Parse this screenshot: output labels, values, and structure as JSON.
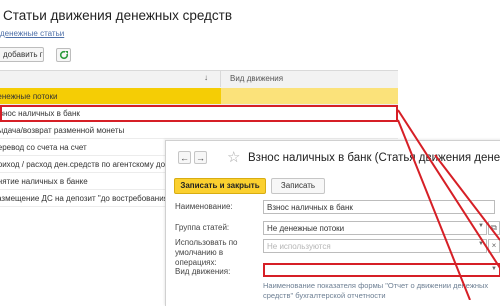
{
  "page": {
    "title": "Статьи движения денежных средств",
    "breadcrumb_link": "денежные статьи",
    "add_group_label": "добавить группу"
  },
  "table": {
    "col_name_sort": "↓",
    "col_kind": "Вид движения",
    "rows": [
      "Денежные потоки",
      "Взнос наличных в банк",
      "Выдача/возврат разменной монеты",
      "Перевод со счета на счет",
      "Приход / расход ден.средств по агентскому догово",
      "Снятие наличных в банке",
      "Размещение ДС на депозит \"до востребования\""
    ]
  },
  "dialog": {
    "title": "Взнос наличных в банк (Статья движения денежных",
    "save_close_label": "Записать и закрыть",
    "save_label": "Записать",
    "fields": {
      "name_label": "Наименование:",
      "name_value": "Взнос наличных в банк",
      "group_label": "Группа статей:",
      "group_value": "Не денежные потоки",
      "default_label": "Использовать по умолчанию в операциях:",
      "default_value": "Не используются",
      "kind_label": "Вид движения:",
      "kind_value": ""
    },
    "hint": "Наименование показателя формы \"Отчет о движении денежных средств\" бухгалтерской отчетности"
  },
  "colors": {
    "accent": "#f5cd05",
    "annotation": "#d61f26"
  }
}
